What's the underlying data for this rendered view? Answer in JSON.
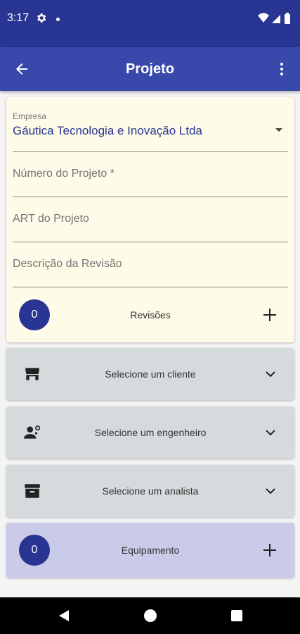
{
  "status": {
    "time": "3:17"
  },
  "app_bar": {
    "title": "Projeto"
  },
  "form": {
    "empresa": {
      "label": "Empresa",
      "value": "Gáutica Tecnologia e Inovação Ltda"
    },
    "numero": {
      "placeholder": "Número do Projeto *"
    },
    "art": {
      "placeholder": "ART do Projeto"
    },
    "descricao": {
      "placeholder": "Descrição da Revisão"
    },
    "revisoes": {
      "count": "0",
      "label": "Revisões"
    }
  },
  "selectors": {
    "cliente": {
      "label": "Selecione um cliente",
      "icon": "store-icon"
    },
    "engenheiro": {
      "label": "Selecione um engenheiro",
      "icon": "engineer-icon"
    },
    "analista": {
      "label": "Selecione um analista",
      "icon": "archive-icon"
    }
  },
  "equipamento": {
    "count": "0",
    "label": "Equipamento"
  },
  "colors": {
    "status_bar": "#283593",
    "app_bar": "#3949ab",
    "form_card": "#fefce8",
    "selector_card": "#d5dbdc",
    "equip_card": "#c9cbe9",
    "badge": "#283593"
  }
}
